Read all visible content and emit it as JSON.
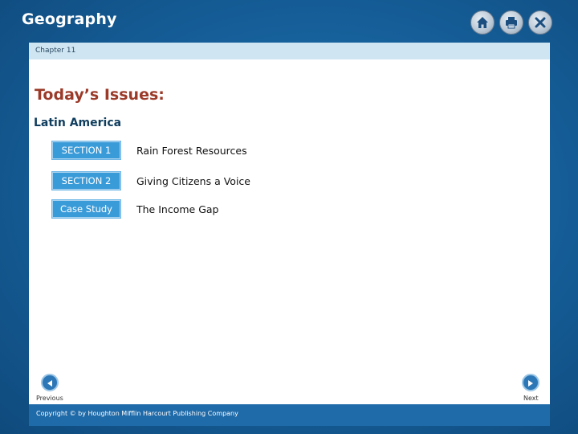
{
  "app": {
    "title": "Geography"
  },
  "toolbar": {
    "icons": [
      "home-icon",
      "print-icon",
      "close-icon"
    ]
  },
  "chapter": {
    "label": "Chapter 11"
  },
  "main": {
    "title": "Today’s Issues:",
    "subtitle": "Latin America",
    "items": [
      {
        "tag": "SECTION 1",
        "label": "Rain Forest Resources"
      },
      {
        "tag": "SECTION 2",
        "label": "Giving Citizens a Voice"
      },
      {
        "tag": "Case Study",
        "label": "The Income Gap"
      }
    ]
  },
  "nav": {
    "previous_label": "Previous",
    "next_label": "Next"
  },
  "footer": {
    "copyright": "Copyright © by Houghton Mifflin Harcourt Publishing Company"
  },
  "colors": {
    "background": "#155d97",
    "heading": "#9b3a29",
    "tag": "#3a9bd9",
    "chapter_bar": "#cfe6f2",
    "footer": "#1f6aa8"
  }
}
